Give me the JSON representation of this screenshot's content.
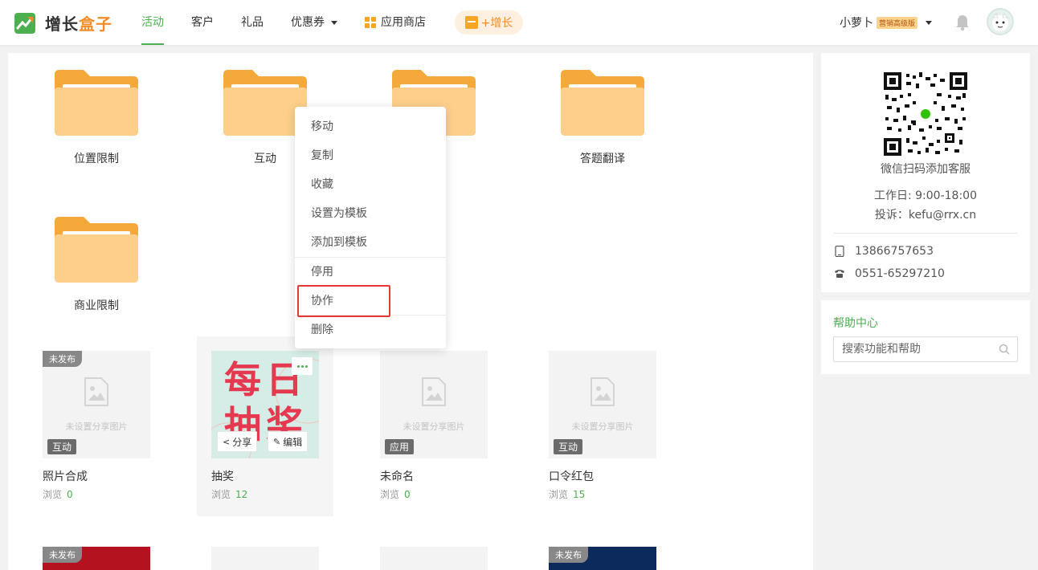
{
  "header": {
    "logo_text_a": "增长",
    "logo_text_b": "盒子",
    "nav": [
      {
        "label": "活动",
        "active": true
      },
      {
        "label": "客户"
      },
      {
        "label": "礼品"
      },
      {
        "label": "优惠券"
      },
      {
        "label": "应用商店"
      }
    ],
    "grow_button": "+增长",
    "user_name": "小萝卜",
    "user_badge": "营销高级版"
  },
  "folders": [
    {
      "name": "位置限制"
    },
    {
      "name": "互动"
    },
    {
      "name": ""
    },
    {
      "name": "答题翻译"
    },
    {
      "name": "商业限制"
    }
  ],
  "cards": [
    {
      "title": "照片合成",
      "views_label": "浏览",
      "views": "0",
      "status": "未发布",
      "type": "互动",
      "empty_text": "未设置分享图片"
    },
    {
      "title": "抽奖",
      "views_label": "浏览",
      "views": "12",
      "share": "分享",
      "edit": "编辑",
      "poster_text_1": "每日",
      "poster_text_2": "抽奖"
    },
    {
      "title": "未命名",
      "views_label": "浏览",
      "views": "0",
      "type": "应用",
      "empty_text": "未设置分享图片"
    },
    {
      "title": "口令红包",
      "views_label": "浏览",
      "views": "15",
      "type": "互动",
      "empty_text": "未设置分享图片"
    }
  ],
  "bottom_tags": {
    "left": "未发布",
    "right": "未发布"
  },
  "context_menu": {
    "items": [
      "移动",
      "复制",
      "收藏",
      "设置为模板",
      "添加到模板",
      "停用",
      "协作",
      "删除"
    ]
  },
  "side": {
    "qr_caption": "微信扫码添加客服",
    "hours": "工作日: 9:00-18:00",
    "complaint": "投诉：kefu@rrx.cn",
    "mobile": "13866757653",
    "phone": "0551-65297210",
    "help_title": "帮助中心",
    "help_placeholder": "搜索功能和帮助"
  },
  "colors": {
    "accent": "#4caf50",
    "brand_orange": "#f28c28",
    "folder": "#fbc46a",
    "highlight": "#e53935"
  }
}
